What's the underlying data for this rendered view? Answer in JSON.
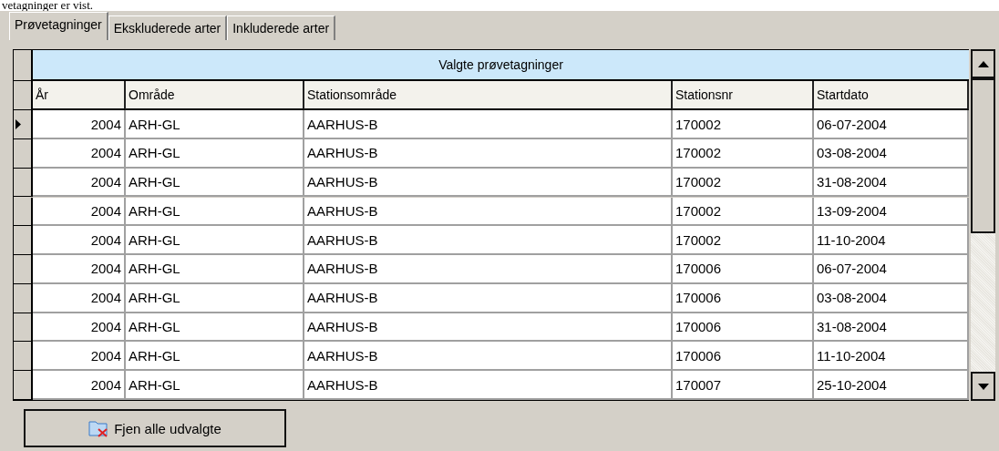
{
  "caption": "vetagninger er vist.",
  "tabs": [
    {
      "label": "Prøvetagninger",
      "selected": true
    },
    {
      "label": "Ekskluderede arter",
      "selected": false
    },
    {
      "label": "Inkluderede arter",
      "selected": false
    }
  ],
  "table": {
    "title": "Valgte prøvetagninger",
    "columns": [
      "År",
      "Område",
      "Stationsområde",
      "Stationsnr",
      "Startdato"
    ],
    "rows": [
      {
        "cells": [
          "2004",
          "ARH-GL",
          "AARHUS-B",
          "170002",
          "06-07-2004"
        ],
        "selected": true
      },
      {
        "cells": [
          "2004",
          "ARH-GL",
          "AARHUS-B",
          "170002",
          "03-08-2004"
        ],
        "selected": false
      },
      {
        "cells": [
          "2004",
          "ARH-GL",
          "AARHUS-B",
          "170002",
          "31-08-2004"
        ],
        "selected": false
      },
      {
        "cells": [
          "2004",
          "ARH-GL",
          "AARHUS-B",
          "170002",
          "13-09-2004"
        ],
        "selected": false
      },
      {
        "cells": [
          "2004",
          "ARH-GL",
          "AARHUS-B",
          "170002",
          "11-10-2004"
        ],
        "selected": false
      },
      {
        "cells": [
          "2004",
          "ARH-GL",
          "AARHUS-B",
          "170006",
          "06-07-2004"
        ],
        "selected": false
      },
      {
        "cells": [
          "2004",
          "ARH-GL",
          "AARHUS-B",
          "170006",
          "03-08-2004"
        ],
        "selected": false
      },
      {
        "cells": [
          "2004",
          "ARH-GL",
          "AARHUS-B",
          "170006",
          "31-08-2004"
        ],
        "selected": false
      },
      {
        "cells": [
          "2004",
          "ARH-GL",
          "AARHUS-B",
          "170006",
          "11-10-2004"
        ],
        "selected": false
      },
      {
        "cells": [
          "2004",
          "ARH-GL",
          "AARHUS-B",
          "170007",
          "25-10-2004"
        ],
        "selected": false
      }
    ]
  },
  "button": {
    "label": "Fjen alle udvalgte"
  }
}
